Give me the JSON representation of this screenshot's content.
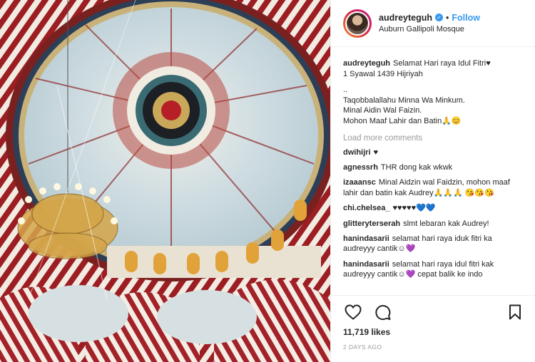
{
  "header": {
    "username": "audreyteguh",
    "follow_label": "Follow",
    "separator": "•",
    "location": "Auburn Gallipoli Mosque"
  },
  "caption": {
    "username": "audreyteguh",
    "lines": [
      "Selamat Hari raya Idul Fitri♥",
      "1 Syawal 1439 Hijriyah",
      "..",
      "Taqobbalallahu Minna Wa Minkum.",
      "Minal Aidin Wal Faizin.",
      "Mohon Maaf Lahir dan Batin🙏😊"
    ]
  },
  "load_more": "Load more comments",
  "comments": [
    {
      "user": "dwihijri",
      "text": "♥"
    },
    {
      "user": "agnessrh",
      "text": "THR dong kak wkwk"
    },
    {
      "user": "izaaansc",
      "text": "Minal Aidzin wal Faidzin, mohon maaf lahir dan batin kak Audrey🙏🙏🙏 😘😘😘"
    },
    {
      "user": "chi.chelsea_",
      "text": "♥♥♥♥♥💙💙"
    },
    {
      "user": "glitteryterserah",
      "text": "slmt lebaran kak Audrey!"
    },
    {
      "user": "hanindasarii",
      "text": "selamat hari raya iduk fitri ka audreyyy cantik☺💜"
    },
    {
      "user": "hanindasarii",
      "text": "selamat hari raya idul fitri kak audreyyy cantik☺💜 cepat balik ke indo"
    }
  ],
  "icons": {
    "like": "heart-icon",
    "comment": "comment-icon",
    "share": "share-icon",
    "save": "bookmark-icon"
  },
  "likes": "11,719 likes",
  "timestamp": "2 DAYS AGO",
  "colors": {
    "link": "#3897f0",
    "border": "#efefef",
    "muted": "#999999",
    "verified": "#3897f0"
  }
}
